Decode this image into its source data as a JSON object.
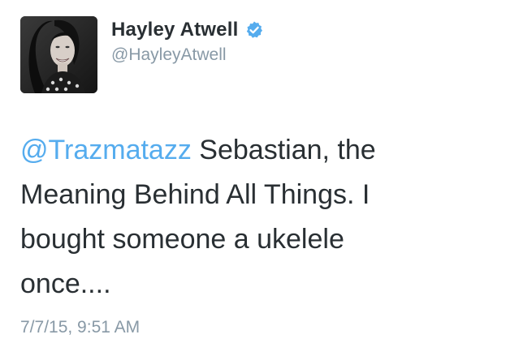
{
  "tweet": {
    "author": {
      "display_name": "Hayley Atwell",
      "handle": "@HayleyAtwell",
      "verified": true,
      "avatar_icon": "profile-photo"
    },
    "text": {
      "mention": "@Trazmatazz",
      "line1_rest": " Sebastian, the",
      "line2": "Meaning Behind All Things. I",
      "line3": "bought someone a ukelele",
      "line4": "once...."
    },
    "timestamp": "7/7/15, 9:51 AM"
  },
  "colors": {
    "name": "#292f33",
    "secondary": "#8899a6",
    "link": "#55acee",
    "verified": "#55acee"
  }
}
